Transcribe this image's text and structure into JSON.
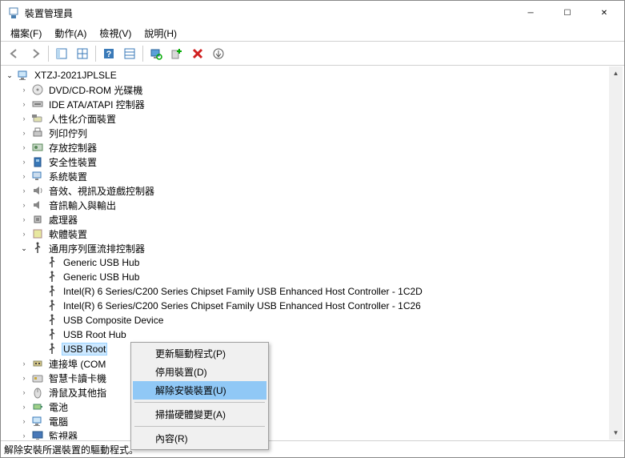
{
  "window": {
    "title": "裝置管理員"
  },
  "winbtns": {
    "min": "─",
    "max": "☐",
    "close": "✕"
  },
  "menu": [
    "檔案(F)",
    "動作(A)",
    "檢視(V)",
    "說明(H)"
  ],
  "tree": {
    "root": "XTZJ-2021JPLSLE",
    "cats": [
      {
        "icon": "disc",
        "label": "DVD/CD-ROM 光碟機"
      },
      {
        "icon": "ide",
        "label": "IDE ATA/ATAPI 控制器"
      },
      {
        "icon": "hid",
        "label": "人性化介面裝置"
      },
      {
        "icon": "printer",
        "label": "列印佇列"
      },
      {
        "icon": "storage",
        "label": "存放控制器"
      },
      {
        "icon": "security",
        "label": "安全性裝置"
      },
      {
        "icon": "system",
        "label": "系統裝置"
      },
      {
        "icon": "sound",
        "label": "音效、視訊及遊戲控制器"
      },
      {
        "icon": "audioio",
        "label": "音訊輸入與輸出"
      },
      {
        "icon": "cpu",
        "label": "處理器"
      },
      {
        "icon": "software",
        "label": "軟體裝置"
      }
    ],
    "usb_cat": "通用序列匯流排控制器",
    "usb_children": [
      "Generic USB Hub",
      "Generic USB Hub",
      "Intel(R) 6 Series/C200 Series Chipset Family USB Enhanced Host Controller - 1C2D",
      "Intel(R) 6 Series/C200 Series Chipset Family USB Enhanced Host Controller - 1C26",
      "USB Composite Device",
      "USB Root Hub",
      "USB Root"
    ],
    "after": [
      {
        "icon": "port",
        "label": "連接埠 (COM"
      },
      {
        "icon": "smartcard",
        "label": "智慧卡讀卡機"
      },
      {
        "icon": "mouse",
        "label": "滑鼠及其他指"
      },
      {
        "icon": "battery",
        "label": "電池"
      },
      {
        "icon": "computer",
        "label": "電腦"
      },
      {
        "icon": "monitor",
        "label": "監視器"
      }
    ]
  },
  "ctx": {
    "items": [
      "更新驅動程式(P)",
      "停用裝置(D)",
      "解除安裝裝置(U)",
      "掃描硬體變更(A)",
      "內容(R)"
    ]
  },
  "status": "解除安裝所選裝置的驅動程式。"
}
